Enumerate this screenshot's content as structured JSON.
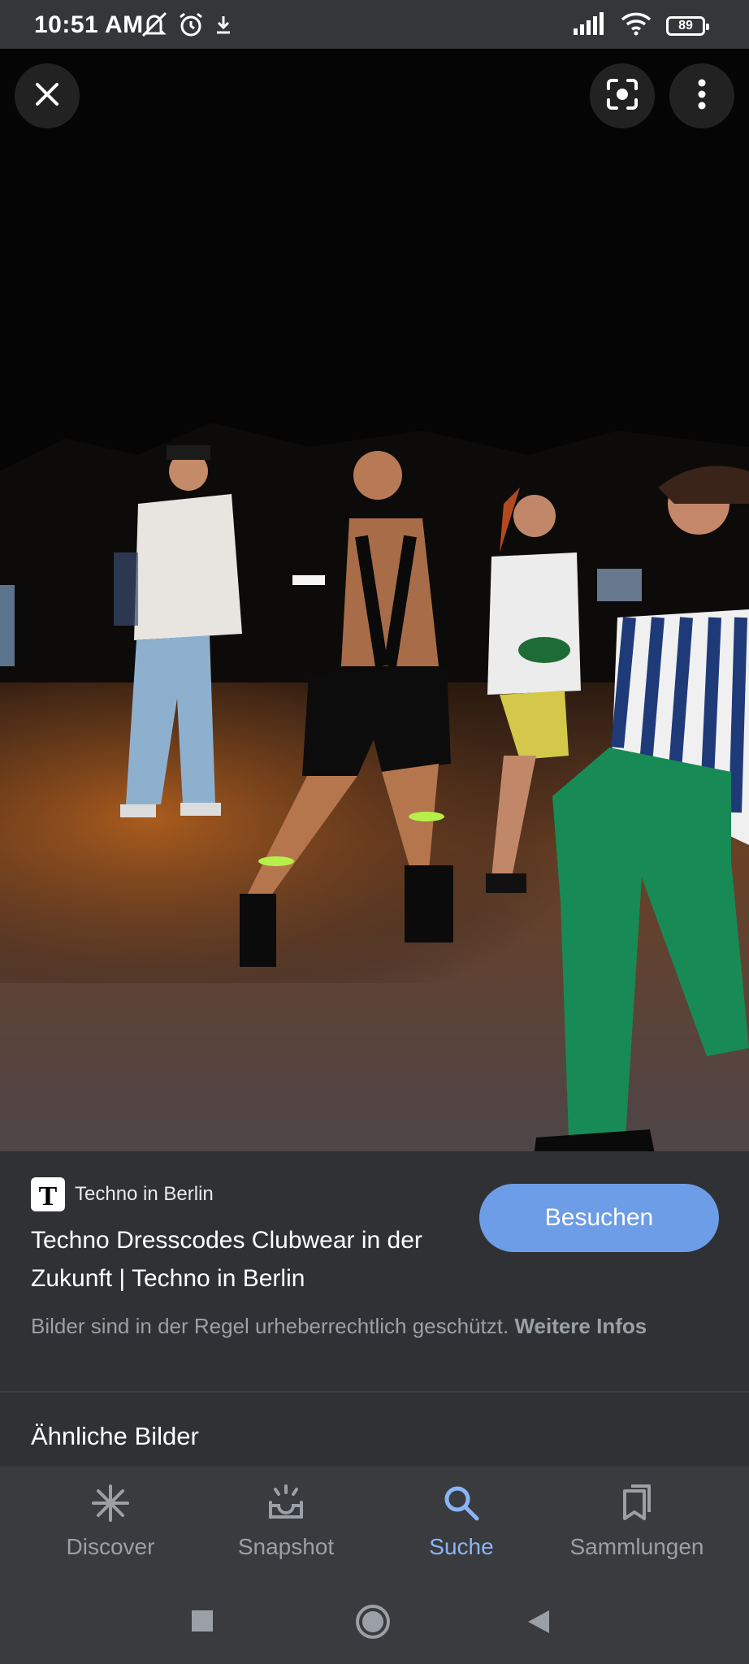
{
  "status_bar": {
    "time": "10:51 AM",
    "battery": "89",
    "icons": [
      "mute-icon",
      "alarm-icon",
      "download-icon",
      "signal-icon",
      "wifi-icon",
      "battery-icon"
    ]
  },
  "viewer": {
    "icons": [
      "close-icon",
      "lens-icon",
      "more-vert-icon"
    ]
  },
  "result": {
    "source_name": "Techno in Berlin",
    "favicon_letter": "T",
    "title": "Techno Dresscodes Clubwear in der Zukunft | Techno in Berlin",
    "visit_label": "Besuchen",
    "copyright_text": "Bilder sind in der Regel urheberrechtlich geschützt.",
    "more_info_label": "Weitere Infos",
    "similar_heading": "Ähnliche Bilder"
  },
  "bottom_nav": {
    "items": [
      {
        "label": "Discover",
        "icon": "discover-icon",
        "active": false
      },
      {
        "label": "Snapshot",
        "icon": "snapshot-icon",
        "active": false
      },
      {
        "label": "Suche",
        "icon": "search-icon",
        "active": true
      },
      {
        "label": "Sammlungen",
        "icon": "collections-icon",
        "active": false
      }
    ]
  },
  "colors": {
    "accent": "#8ab4f8",
    "button": "#6c9de6",
    "background": "#303134"
  }
}
